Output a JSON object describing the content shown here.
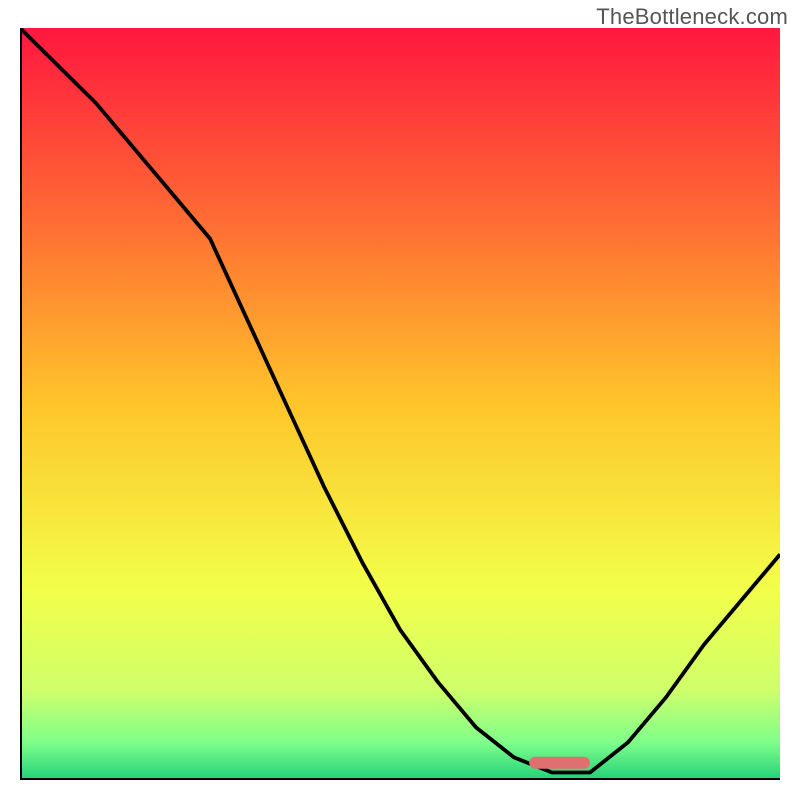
{
  "watermark": "TheBottleneck.com",
  "chart_data": {
    "type": "line",
    "title": "",
    "xlabel": "",
    "ylabel": "",
    "xlim": [
      0,
      100
    ],
    "ylim": [
      0,
      100
    ],
    "grid": false,
    "legend": false,
    "marker": {
      "x_range": [
        67,
        75
      ],
      "y": 2.3,
      "color": "#e07070"
    },
    "series": [
      {
        "name": "curve",
        "x": [
          0,
          5,
          10,
          15,
          20,
          25,
          30,
          35,
          40,
          45,
          50,
          55,
          60,
          65,
          70,
          75,
          80,
          85,
          90,
          95,
          100
        ],
        "y": [
          100,
          95,
          90,
          84,
          78,
          72,
          61,
          50,
          39,
          29,
          20,
          13,
          7,
          3,
          1,
          1,
          5,
          11,
          18,
          24,
          30
        ]
      }
    ],
    "background": {
      "type": "vertical-gradient",
      "stops": [
        {
          "offset": 0.0,
          "color": "#ff173f"
        },
        {
          "offset": 0.25,
          "color": "#ff6a34"
        },
        {
          "offset": 0.5,
          "color": "#ffc52a"
        },
        {
          "offset": 0.75,
          "color": "#f2ff4a"
        },
        {
          "offset": 0.88,
          "color": "#cfff6a"
        },
        {
          "offset": 0.95,
          "color": "#7fff8a"
        },
        {
          "offset": 1.0,
          "color": "#21d17a"
        }
      ]
    },
    "axes": {
      "color": "#000000",
      "width": 4
    }
  }
}
